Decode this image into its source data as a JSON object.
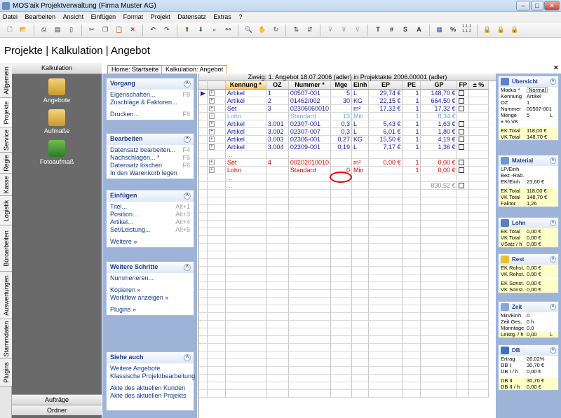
{
  "window": {
    "title": "MOS'aik Projektverwaltung (Firma Muster AG)",
    "buttons": [
      "–",
      "□",
      "✕"
    ]
  },
  "menu": [
    "Datei",
    "Bearbeiten",
    "Ansicht",
    "Einfügen",
    "Format",
    "Projekt",
    "Datensatz",
    "Extras",
    "?"
  ],
  "toolbar": {
    "icons": [
      "new-doc-icon",
      "open-folder-icon",
      "print-icon",
      "print-preview-icon",
      "copy-doc-icon",
      "cut-icon",
      "copy-icon",
      "paste-icon",
      "delete-icon",
      "undo-icon",
      "redo-icon",
      "arrow-up-icon",
      "arrow-down-icon",
      "find-icon",
      "binoculars-icon",
      "zoom-icon",
      "hand-icon",
      "refresh-icon",
      "sort-asc-icon",
      "sort-desc-icon",
      "filter-icon",
      "filter-remove-icon",
      "filter-clear-icon",
      "text-icon",
      "hash-icon",
      "s-icon",
      "a-icon",
      "calc-icon",
      "percent-icon",
      "numbering-icon",
      "lock-blue-icon",
      "lock-yellow-icon",
      "lock-red-icon"
    ],
    "text_glyphs": {
      "text": "T",
      "hash": "#",
      "s": "S",
      "a": "A",
      "percent": "%",
      "numbering": "1.1.1\n1.1.2"
    }
  },
  "page": {
    "title": "Projekte | Kalkulation | Angebot"
  },
  "vertical_tabs": [
    "Allgemein",
    "Projekte",
    "Service",
    "Regie",
    "Kasse",
    "Logistik",
    "Büroarbeiten",
    "Auswertungen",
    "Stammdaten",
    "Plugins"
  ],
  "left_panel": {
    "header": "Kalkulation",
    "items": [
      "Angebote",
      "Aufmaße",
      "Fotoaufmaß"
    ],
    "footer": [
      "Aufträge",
      "Ordner"
    ]
  },
  "doc_tabs": [
    "Home: Startseite",
    "Kalkulation: Angebot"
  ],
  "tasks": {
    "vorgang": {
      "title": "Vorgang",
      "items": [
        {
          "label": "Eigenschaften...",
          "key": "F8"
        },
        {
          "label": "Zuschläge & Faktoren...",
          "key": ""
        },
        {
          "label": "Drucken...",
          "key": "F9"
        }
      ]
    },
    "bearbeiten": {
      "title": "Bearbeiten",
      "items": [
        {
          "label": "Datensatz bearbeiten...",
          "key": "F4"
        },
        {
          "label": "Nachschlagen...  *",
          "key": "F5"
        },
        {
          "label": "Datensatz löschen",
          "key": "F6"
        },
        {
          "label": "In den Warenkorb legen",
          "key": ""
        }
      ]
    },
    "einfuegen": {
      "title": "Einfügen",
      "items": [
        {
          "label": "Titel...",
          "key": "Alt+1"
        },
        {
          "label": "Position...",
          "key": "Alt+3"
        },
        {
          "label": "Artikel...",
          "key": "Alt+4"
        },
        {
          "label": "Set/Leistung...",
          "key": "Alt+5"
        },
        {
          "label": "Weitere »",
          "key": ""
        }
      ]
    },
    "weitere": {
      "title": "Weitere Schritte",
      "items": [
        {
          "label": "Nummerieren..."
        },
        {
          "label": "Kopieren »"
        },
        {
          "label": "Workflow anzeigen »"
        },
        {
          "label": "Plugins »"
        }
      ]
    },
    "siehe": {
      "title": "Siehe auch",
      "items": [
        {
          "label": "Weitere Angebote"
        },
        {
          "label": "Klassische Projektbearbeitung"
        },
        {
          "label": "Akte des aktuellen Kunden"
        },
        {
          "label": "Akte des aktuellen Projekts"
        }
      ]
    }
  },
  "grid": {
    "caption": "Zweig: 1. Angebot 18.07.2006 (adler) in Projektakte 2006.00001 (adler)",
    "columns": [
      "",
      "",
      "Kennung *",
      "OZ",
      "Nummer *",
      "Mge",
      "Einh",
      "EP",
      "PE",
      "GP",
      "FP",
      "± %"
    ],
    "rows": [
      {
        "cls": "blue",
        "ind": "▶",
        "kenn": "Artikel",
        "oz": "1",
        "nr": "00507-001",
        "mge": "5",
        "einh": "L",
        "ep": "29,74 €",
        "pe": "1",
        "gp": "148,70 €",
        "fp": true
      },
      {
        "cls": "blue",
        "ind": "",
        "kenn": "Artikel",
        "oz": "2",
        "nr": "01462/002",
        "mge": "30",
        "einh": "KG",
        "ep": "22,15 €",
        "pe": "1",
        "gp": "664,50 €",
        "fp": true
      },
      {
        "cls": "blue",
        "ind": "",
        "kenn": "Set",
        "oz": "3",
        "nr": "02306060010",
        "mge": "",
        "einh": "m²",
        "ep": "17,32 €",
        "pe": "1",
        "gp": "17,32 €",
        "fp": true
      },
      {
        "cls": "lightblue",
        "ind": "",
        "kenn": "Lohn",
        "oz": "",
        "nr": "Standard",
        "mge": "13",
        "einh": "Min",
        "ep": "",
        "pe": "1",
        "gp": "8,34 €",
        "fp": false
      },
      {
        "cls": "blue",
        "ind": "",
        "kenn": "Artikel",
        "oz": "3.001",
        "nr": "02307-001",
        "mge": "0,3",
        "einh": "L",
        "ep": "5,43 €",
        "pe": "1",
        "gp": "1,63 €",
        "fp": true
      },
      {
        "cls": "blue",
        "ind": "",
        "kenn": "Artikel",
        "oz": "3.002",
        "nr": "02307-007",
        "mge": "0,3",
        "einh": "L",
        "ep": "6,01 €",
        "pe": "1",
        "gp": "1,80 €",
        "fp": true
      },
      {
        "cls": "blue",
        "ind": "",
        "kenn": "Artikel",
        "oz": "3.003",
        "nr": "02306-001",
        "mge": "0,27",
        "einh": "KG",
        "ep": "15,50 €",
        "pe": "1",
        "gp": "4,19 €",
        "fp": true
      },
      {
        "cls": "blue",
        "ind": "",
        "kenn": "Artikel",
        "oz": "3.004",
        "nr": "02309-001",
        "mge": "0,19",
        "einh": "L",
        "ep": "7,17 €",
        "pe": "1",
        "gp": "1,36 €",
        "fp": true
      },
      {
        "cls": "gray",
        "ind": "",
        "kenn": "...",
        "oz": "",
        "nr": "",
        "mge": "",
        "einh": "",
        "ep": "",
        "pe": "",
        "gp": "",
        "fp": false
      },
      {
        "cls": "red",
        "ind": "",
        "kenn": "Set",
        "oz": "4",
        "nr": "00202010010",
        "mge": "",
        "einh": "m²",
        "ep": "0,00 €",
        "pe": "1",
        "gp": "0,00 €",
        "fp": true
      },
      {
        "cls": "red",
        "ind": "",
        "kenn": "Lohn",
        "oz": "",
        "nr": "Standard",
        "mge": "0",
        "einh": "Min",
        "ep": "",
        "pe": "1",
        "gp": "0,00 €",
        "fp": true
      },
      {
        "cls": "gray",
        "ind": "",
        "kenn": "...",
        "oz": "",
        "nr": "",
        "mge": "",
        "einh": "",
        "ep": "",
        "pe": "",
        "gp": "",
        "fp": false
      },
      {
        "cls": "gray",
        "ind": "",
        "kenn": "...",
        "oz": "",
        "nr": "",
        "mge": "",
        "einh": "",
        "ep": "",
        "pe": "",
        "gp": "830,52 €",
        "fp": true
      }
    ]
  },
  "summary": {
    "uebersicht": {
      "title": "Übersicht",
      "rows": [
        {
          "k": "Modus *",
          "v": "Normal",
          "box": true
        },
        {
          "k": "Kennung",
          "v": "Artikel"
        },
        {
          "k": "OZ",
          "v": "1"
        },
        {
          "k": "Nummer",
          "v": "00507-001"
        },
        {
          "k": "Menge",
          "v": "5",
          "u": "L"
        },
        {
          "k": "± % VK",
          "v": ""
        },
        {
          "sp": true
        },
        {
          "k": "EK Total",
          "v": "118,00 €",
          "hl": true
        },
        {
          "k": "VK Total",
          "v": "148,70 €",
          "hl": true
        }
      ]
    },
    "material": {
      "title": "Material",
      "rows": [
        {
          "k": "LP/Einh",
          "v": ""
        },
        {
          "k": "Bez.-Rab.",
          "v": ""
        },
        {
          "k": "EK/Einh",
          "v": "23,60 €"
        },
        {
          "sp": true
        },
        {
          "k": "EK Total",
          "v": "118,00 €",
          "hl": true
        },
        {
          "k": "VK Total",
          "v": "148,70 €",
          "hl": true
        },
        {
          "k": "Faktor",
          "v": "1,26",
          "hl": true
        }
      ]
    },
    "lohn": {
      "title": "Lohn",
      "rows": [
        {
          "k": "EK Total",
          "v": "0,00 €",
          "hl": true
        },
        {
          "k": "VK Total",
          "v": "0,00 €",
          "hl": true
        },
        {
          "k": "VSatz / h",
          "v": "0,00 €",
          "hl": true
        }
      ]
    },
    "rest": {
      "title": "Rest",
      "rows": [
        {
          "k": "EK Rohst.",
          "v": "0,00 €",
          "hl": true
        },
        {
          "k": "VK Rohst.",
          "v": "0,00 €",
          "hl": true
        },
        {
          "sp": true
        },
        {
          "k": "EK Sonst.",
          "v": "0,00 €",
          "hl": true
        },
        {
          "k": "VK Sonst.",
          "v": "0,00 €",
          "hl": true
        }
      ]
    },
    "zeit": {
      "title": "Zeit",
      "rows": [
        {
          "k": "Min/Einh",
          "v": "0"
        },
        {
          "k": "Zeit Ges.",
          "v": "0 h"
        },
        {
          "k": "Manntage",
          "v": "0,0"
        },
        {
          "k": "Leistg. / h",
          "v": "0,00",
          "u": "L",
          "hl": true
        }
      ]
    },
    "db": {
      "title": "DB",
      "rows": [
        {
          "k": "Ertrag",
          "v": "26,02%"
        },
        {
          "k": "DB I",
          "v": "30,70 €"
        },
        {
          "k": "DB I / h",
          "v": "0,00 €"
        },
        {
          "sp": true
        },
        {
          "k": "DB II",
          "v": "30,70 €",
          "hl": true
        },
        {
          "k": "DB II / h",
          "v": "0,00 €",
          "hl": true
        }
      ]
    }
  },
  "colors": {
    "accent": "#1f3d8a",
    "red": "#e00000",
    "blue": "#1a1aa8",
    "panel": "#9db3d8",
    "highlight": "#ffffc8"
  }
}
